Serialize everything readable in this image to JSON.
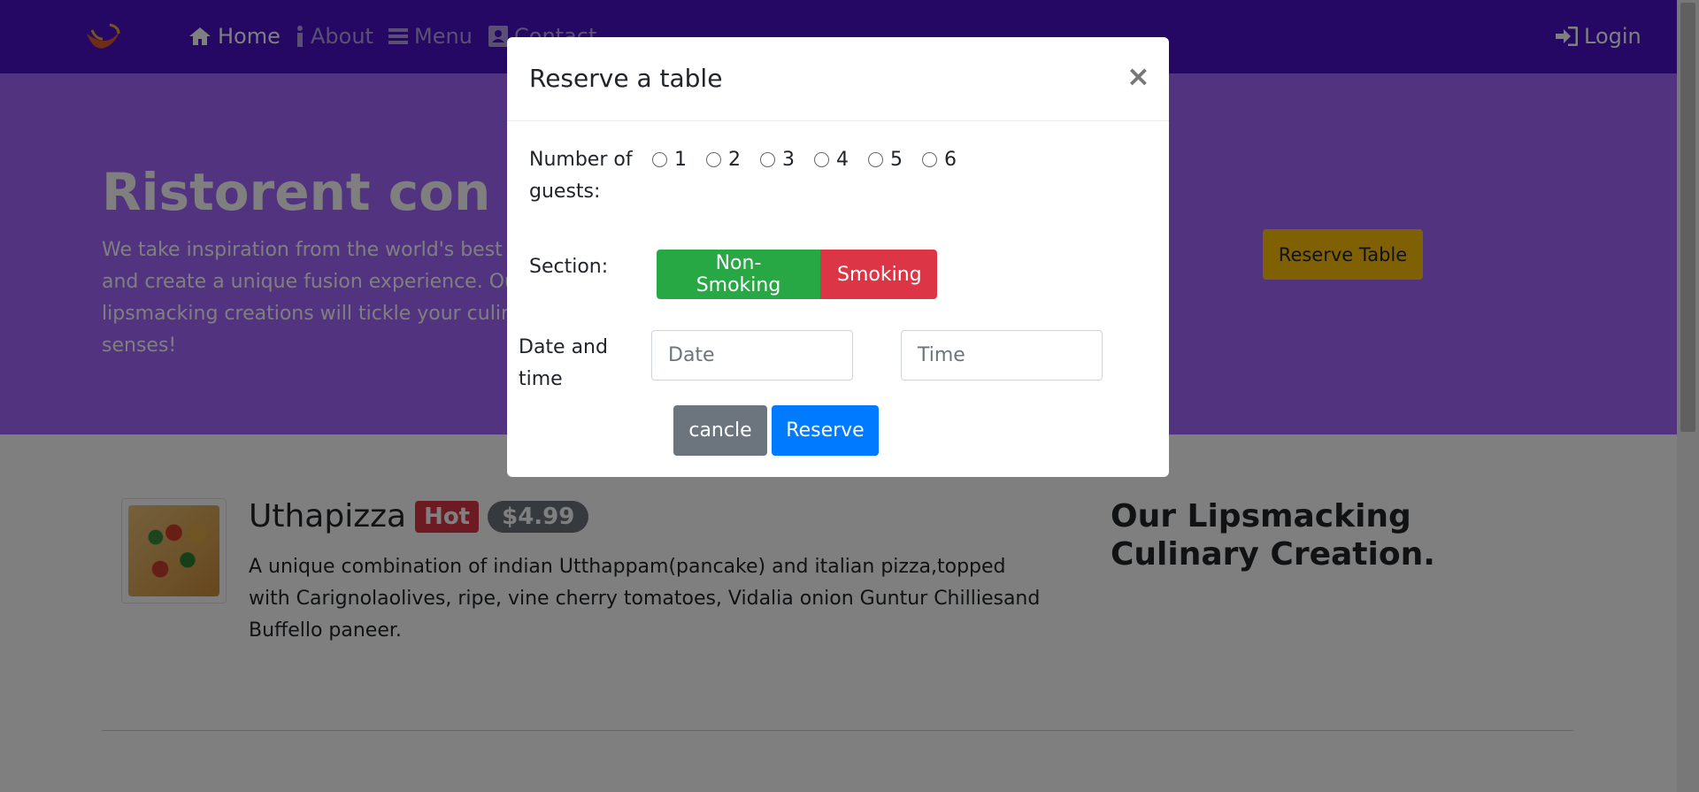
{
  "navbar": {
    "items": [
      {
        "label": "Home",
        "icon": "home-icon"
      },
      {
        "label": "About",
        "icon": "info-icon"
      },
      {
        "label": "Menu",
        "icon": "list-icon"
      },
      {
        "label": "Contact",
        "icon": "contact-card-icon"
      }
    ],
    "login_label": "Login",
    "colors": {
      "background": "#4a11c7"
    }
  },
  "jumbotron": {
    "title": "Ristorent con Fusion",
    "text": "We take inspiration from the world's best cuisines, and create a unique fusion experience. Our lipsmacking creations will tickle your culinary senses!",
    "reserve_button_label": "Reserve Table",
    "colors": {
      "background": "#a566ff",
      "button": "#ffc107"
    }
  },
  "dish": {
    "name": "Uthapizza",
    "badge_hot": "Hot",
    "price": "$4.99",
    "description": "A unique combination of indian Utthappam(pancake) and italian pizza,topped with Carignolaolives, ripe, vine cherry tomatoes, Vidalia onion Guntur Chilliesand Buffello paneer."
  },
  "culinary_title": "Our Lipsmacking Culinary Creation.",
  "modal": {
    "title": "Reserve a table",
    "close_symbol": "×",
    "guests_label": "Number of guests:",
    "guest_options": [
      "1",
      "2",
      "3",
      "4",
      "5",
      "6"
    ],
    "section_label": "Section:",
    "section_options": {
      "non_smoking": "Non-Smoking",
      "smoking": "Smoking"
    },
    "date_time_label": "Date and time",
    "date_placeholder": "Date",
    "time_placeholder": "Time",
    "cancel_label": "cancle",
    "reserve_label": "Reserve",
    "colors": {
      "non_smoking": "#28a745",
      "smoking": "#dc3545",
      "cancel": "#6c757d",
      "reserve": "#007bff"
    }
  }
}
